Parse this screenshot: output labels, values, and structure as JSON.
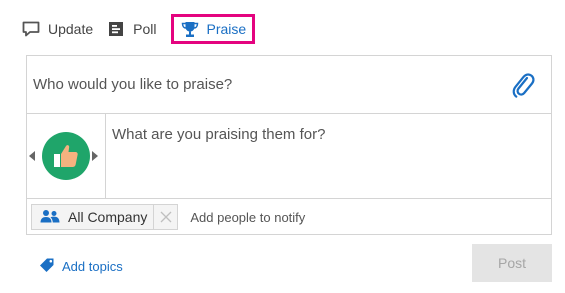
{
  "tabs": [
    {
      "label": "Update",
      "icon": "speech-bubble-icon"
    },
    {
      "label": "Poll",
      "icon": "poll-icon"
    },
    {
      "label": "Praise",
      "icon": "trophy-icon",
      "active": true
    }
  ],
  "praise": {
    "placeholder": "Who would you like to praise?"
  },
  "reason": {
    "placeholder": "What are you praising them for?",
    "badge_icon": "thumbs-up-icon"
  },
  "notify": {
    "group": "All Company",
    "placeholder": "Add people to notify"
  },
  "topics": {
    "label": "Add topics"
  },
  "post": {
    "label": "Post"
  },
  "colors": {
    "accent": "#1a6fc4",
    "highlight": "#e4037f",
    "badge": "#1fa56a",
    "thumb": "#f5b27f",
    "disabled": "#a6a6a6"
  }
}
